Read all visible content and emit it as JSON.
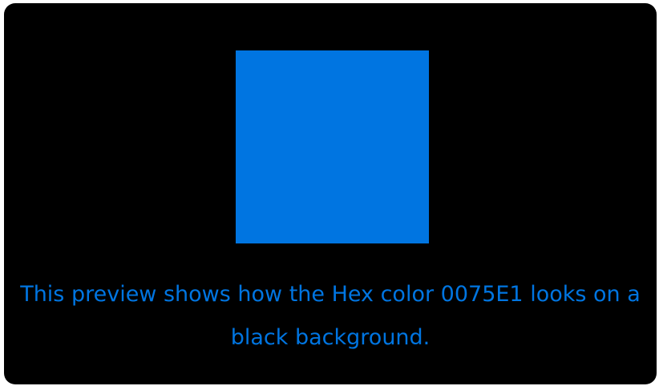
{
  "preview": {
    "background_color": "#000000",
    "swatch_color": "#0075E1",
    "caption": "This preview shows how the Hex color 0075E1 looks on a black background."
  }
}
